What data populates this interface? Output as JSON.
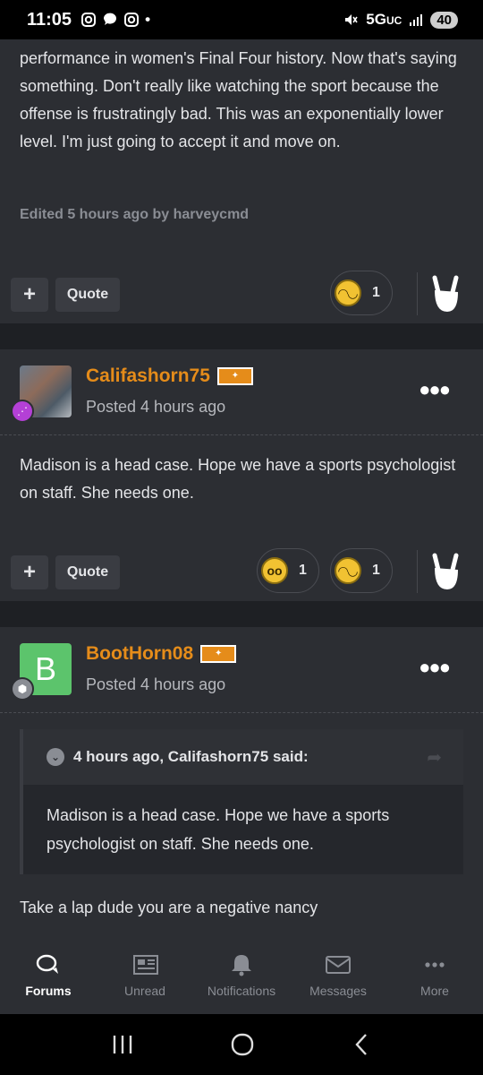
{
  "status_bar": {
    "time": "11:05",
    "network": "5G",
    "network_suffix": "UC",
    "battery": "40"
  },
  "post1": {
    "text": "performance in women's Final Four history. Now that's saying something. Don't really like watching the sport because the offense is frustratingly bad. This was an exponentially lower level. I'm just going to accept it and move on.",
    "edited": "Edited 5 hours ago by harveycmd",
    "quote_label": "Quote",
    "plus_label": "+",
    "reactions": [
      {
        "icon": "worried-face-icon",
        "count": "1"
      }
    ]
  },
  "post2": {
    "username": "Califashorn75",
    "posted": "Posted 4 hours ago",
    "text": "Madison is a head case. Hope we have a sports psychologist on staff. She needs one.",
    "quote_label": "Quote",
    "plus_label": "+",
    "reactions": [
      {
        "icon": "confused-face-icon",
        "count": "1"
      },
      {
        "icon": "worried-face-icon",
        "count": "1"
      }
    ]
  },
  "post3": {
    "username": "BootHorn08",
    "avatar_letter": "B",
    "posted": "Posted 4 hours ago",
    "quote_header": "4 hours ago, Califashorn75 said:",
    "quote_text": "Madison is a head case. Hope we have a sports psychologist on staff. She needs one.",
    "text": "Take a lap dude you are a negative nancy"
  },
  "bottom_nav": [
    {
      "label": "Forums",
      "icon": "forums-icon",
      "active": true
    },
    {
      "label": "Unread",
      "icon": "newspaper-icon",
      "active": false
    },
    {
      "label": "Notifications",
      "icon": "bell-icon",
      "active": false
    },
    {
      "label": "Messages",
      "icon": "envelope-icon",
      "active": false
    },
    {
      "label": "More",
      "icon": "more-dots-icon",
      "active": false
    }
  ],
  "colors": {
    "accent_orange": "#e58c1a",
    "background": "#2c2e33"
  }
}
